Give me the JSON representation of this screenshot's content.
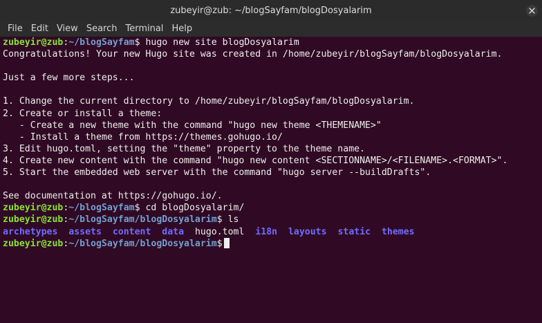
{
  "window": {
    "title": "zubeyir@zub: ~/blogSayfam/blogDosyalarim"
  },
  "menubar": {
    "items": [
      "File",
      "Edit",
      "View",
      "Search",
      "Terminal",
      "Help"
    ]
  },
  "terminal": {
    "prompt1": {
      "user_host": "zubeyir@zub",
      "colon": ":",
      "path": "~/blogSayfam",
      "symbol": "$",
      "command": " hugo new site blogDosyalarim"
    },
    "output": [
      "Congratulations! Your new Hugo site was created in /home/zubeyir/blogSayfam/blogDosyalarim.",
      "",
      "Just a few more steps...",
      "",
      "1. Change the current directory to /home/zubeyir/blogSayfam/blogDosyalarim.",
      "2. Create or install a theme:",
      "   - Create a new theme with the command \"hugo new theme <THEMENAME>\"",
      "   - Install a theme from https://themes.gohugo.io/",
      "3. Edit hugo.toml, setting the \"theme\" property to the theme name.",
      "4. Create new content with the command \"hugo new content <SECTIONNAME>/<FILENAME>.<FORMAT>\".",
      "5. Start the embedded web server with the command \"hugo server --buildDrafts\".",
      "",
      "See documentation at https://gohugo.io/."
    ],
    "prompt2": {
      "user_host": "zubeyir@zub",
      "colon": ":",
      "path": "~/blogSayfam",
      "symbol": "$",
      "command": " cd blogDosyalarim/"
    },
    "prompt3": {
      "user_host": "zubeyir@zub",
      "colon": ":",
      "path": "~/blogSayfam/blogDosyalarim",
      "symbol": "$",
      "command": " ls"
    },
    "ls": {
      "d1": "archetypes",
      "d2": "assets",
      "d3": "content",
      "d4": "data",
      "f1": "hugo.toml",
      "d5": "i18n",
      "d6": "layouts",
      "d7": "static",
      "d8": "themes"
    },
    "prompt4": {
      "user_host": "zubeyir@zub",
      "colon": ":",
      "path": "~/blogSayfam/blogDosyalarim",
      "symbol": "$",
      "command": " "
    }
  },
  "colors": {
    "terminal_bg": "#300a24",
    "user_host": "#8ae234",
    "path": "#729fcf",
    "directory": "#6f6cff",
    "text": "#eeeeec"
  }
}
